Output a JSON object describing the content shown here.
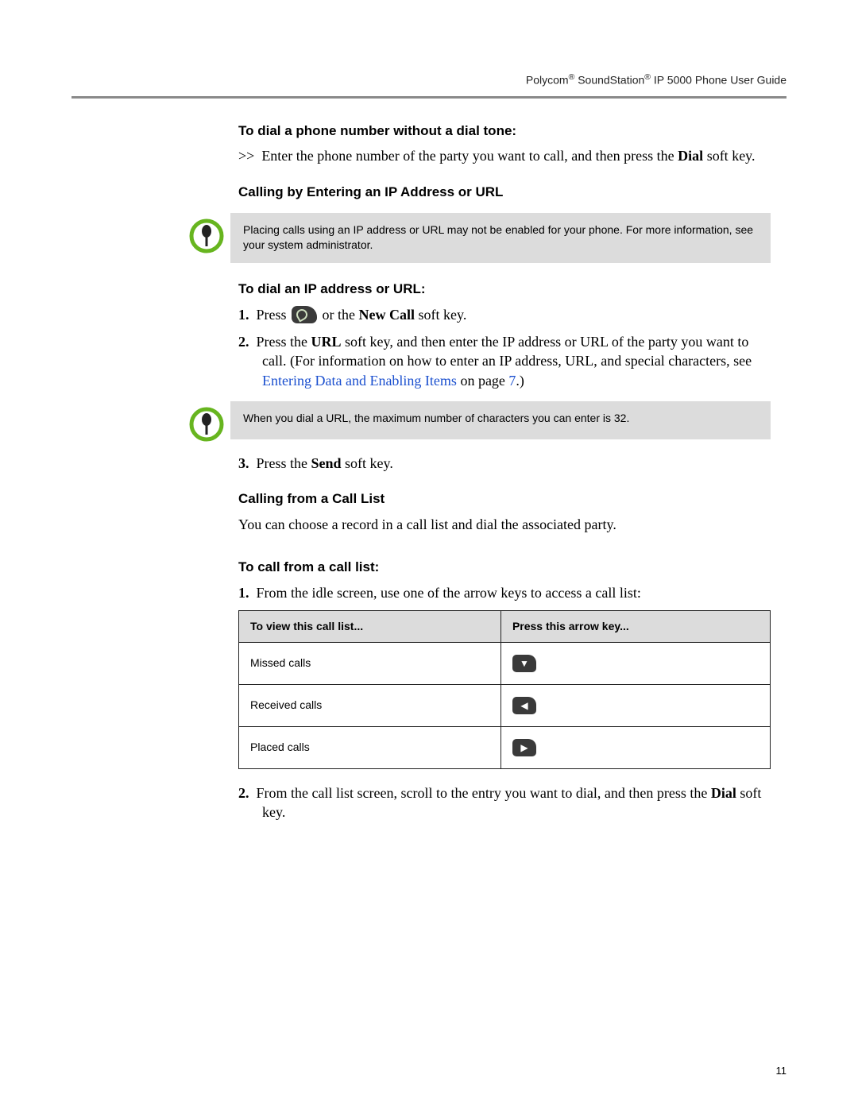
{
  "header": {
    "title_pre": "Polycom",
    "reg1": "®",
    "title_mid": " SoundStation",
    "reg2": "®",
    "title_post": " IP 5000 Phone User Guide"
  },
  "section1": {
    "heading": "To dial a phone number without a dial tone:",
    "arrow": ">>",
    "p1a": "Enter the phone number of the party you want to call, and then press the ",
    "p1b": "Dial",
    "p1c": " soft key."
  },
  "section2": {
    "heading": "Calling by Entering an IP Address or URL",
    "note": "Placing calls using an IP address or URL may not be enabled for your phone. For more information, see your system administrator."
  },
  "section3": {
    "heading": "To dial an IP address or URL:",
    "step1_num": "1.",
    "step1_a": "Press ",
    "step1_b": " or the ",
    "step1_c": "New Call",
    "step1_d": " soft key.",
    "step2_num": "2.",
    "step2_a": "Press the ",
    "step2_b": "URL",
    "step2_c": " soft key, and then enter the IP address or URL of the party you want to call. (For information on how to enter an IP address, URL, and special characters, see ",
    "step2_link": "Entering Data and Enabling Items",
    "step2_d": " on page ",
    "step2_page": "7",
    "step2_e": ".)",
    "note2": "When you dial a URL, the maximum number of characters you can enter is 32.",
    "step3_num": "3.",
    "step3_a": "Press the ",
    "step3_b": "Send",
    "step3_c": " soft key."
  },
  "section4": {
    "heading": "Calling from a Call List",
    "p": "You can choose a record in a call list and dial the associated party."
  },
  "section5": {
    "heading": "To call from a call list:",
    "step1_num": "1.",
    "step1": "From the idle screen, use one of the arrow keys to access a call list:",
    "table": {
      "h1": "To view this call list...",
      "h2": "Press this arrow key...",
      "rows": [
        {
          "label": "Missed calls",
          "glyph": "▼"
        },
        {
          "label": "Received calls",
          "glyph": "◀"
        },
        {
          "label": "Placed calls",
          "glyph": "▶"
        }
      ]
    },
    "step2_num": "2.",
    "step2_a": "From the call list screen, scroll to the entry you want to dial, and then press the ",
    "step2_b": "Dial",
    "step2_c": " soft key."
  },
  "page_number": "11"
}
